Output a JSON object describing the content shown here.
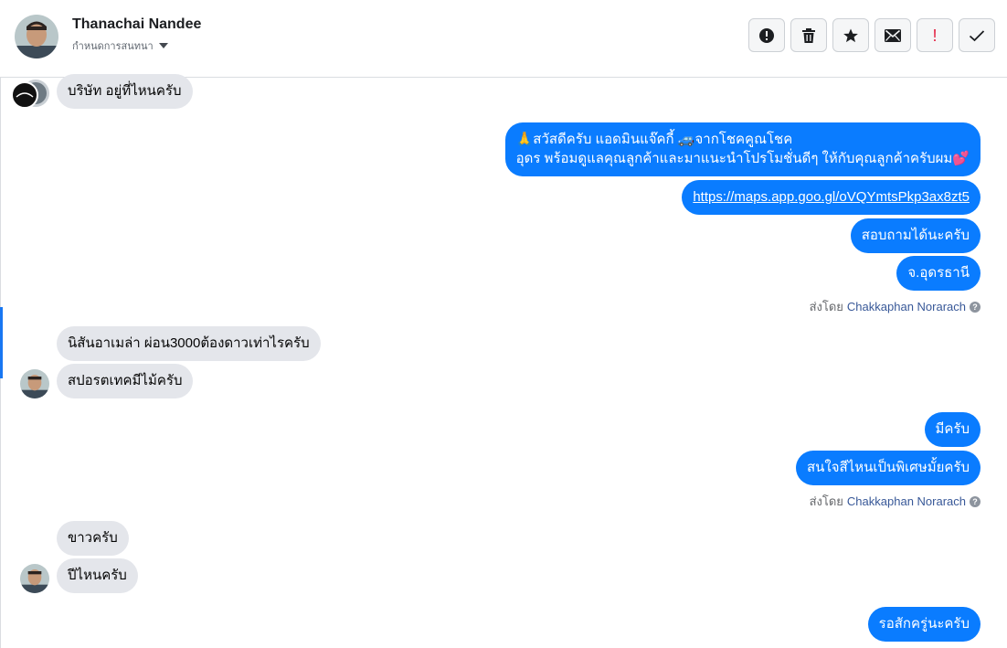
{
  "header": {
    "contact_name": "Thanachai Nandee",
    "status_label": "กำหนดการสนทนา",
    "actions": [
      {
        "name": "alert-button",
        "icon": "exclamation-circle-icon"
      },
      {
        "name": "delete-button",
        "icon": "trash-icon"
      },
      {
        "name": "star-button",
        "icon": "star-icon"
      },
      {
        "name": "mail-button",
        "icon": "envelope-icon"
      },
      {
        "name": "mark-spam-button",
        "icon": "exclamation-icon",
        "label": "!"
      },
      {
        "name": "mark-done-button",
        "icon": "check-icon"
      }
    ]
  },
  "messages": {
    "m1": "บริษัท อยู่ที่ไหนครับ",
    "m2_line1": "🙏สวัสดีครับ แอดมินแจ๊คกี้ 🚙จากโชคคูณโชค",
    "m2_line2": "อุดร พร้อมดูแลคุณลูกค้าและมาแนะนำโปรโมชั่นดีๆ ให้กับคุณลูกค้าครับผม💕",
    "m3_link": "https://maps.app.goo.gl/oVQYmtsPkp3ax8zt5",
    "m4": "สอบถามได้นะครับ",
    "m5": "จ.อุดรธานี",
    "sent_by_1_prefix": "ส่งโดย",
    "sent_by_1_name": "Chakkaphan Norarach",
    "m6": "นิสันอาเมล่า ผ่อน3000ต้องดาวเท่าไรครับ",
    "m7": "สปอรตเทคมีไม้ครับ",
    "m8": "มีครับ",
    "m9": "สนใจสีไหนเป็นพิเศษมั้ยครับ",
    "sent_by_2_prefix": "ส่งโดย",
    "sent_by_2_name": "Chakkaphan Norarach",
    "m10": "ขาวครับ",
    "m11": "ปีไหนครับ",
    "m12": "รอสักครู่นะครับ"
  },
  "colors": {
    "outgoing_bubble": "#0a7cff",
    "incoming_bubble": "#e4e6eb",
    "accent_bar": "#1877f2",
    "spam_icon": "#e41e3f"
  }
}
